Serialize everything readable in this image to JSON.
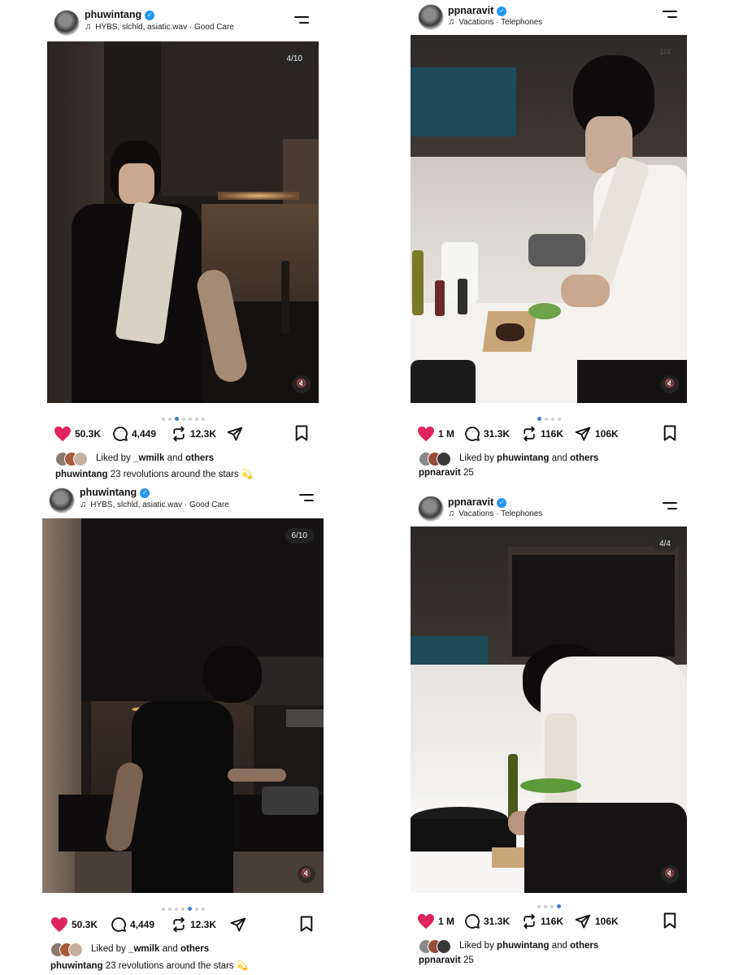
{
  "posts": [
    {
      "username": "phuwintang",
      "music": "HYBS, slchld, asiatic.wav · Good Care",
      "counter": "4/10",
      "likes": "50.3K",
      "comments": "4,449",
      "reposts": "12.3K",
      "liked_by_user": "_wmilk",
      "liked_by_others": "others",
      "caption_user": "phuwintang",
      "caption_text": "23 revolutions around the stars 💫",
      "dots_total": 7,
      "dots_active": 2
    },
    {
      "username": "ppnaravit",
      "music": "Vacations · Telephones",
      "counter": "1/4",
      "likes": "1 M",
      "comments": "31.3K",
      "reposts": "116K",
      "shares": "106K",
      "liked_by_user": "phuwintang",
      "liked_by_others": "others",
      "caption_user": "ppnaravit",
      "caption_text": "25",
      "cut_line": "…",
      "dots_total": 4,
      "dots_active": 0
    },
    {
      "username": "phuwintang",
      "music": "HYBS, slchld, asiatic.wav · Good Care",
      "counter": "6/10",
      "likes": "50.3K",
      "comments": "4,449",
      "reposts": "12.3K",
      "liked_by_user": "_wmilk",
      "liked_by_others": "others",
      "caption_user": "phuwintang",
      "caption_text": "23 revolutions around the stars 💫",
      "dots_total": 7,
      "dots_active": 4
    },
    {
      "username": "ppnaravit",
      "music": "Vacations · Telephones",
      "counter": "4/4",
      "likes": "1 M",
      "comments": "31.3K",
      "reposts": "116K",
      "shares": "106K",
      "liked_by_user": "phuwintang",
      "liked_by_others": "others",
      "caption_user": "ppnaravit",
      "caption_text": "25",
      "cut_line": "…",
      "dots_total": 4,
      "dots_active": 3
    }
  ],
  "labels": {
    "liked_by": "Liked by",
    "and": "and"
  },
  "colors": {
    "heart": "#e0245e",
    "verified": "#2196f3",
    "dot_active": "#3a7bd5"
  }
}
